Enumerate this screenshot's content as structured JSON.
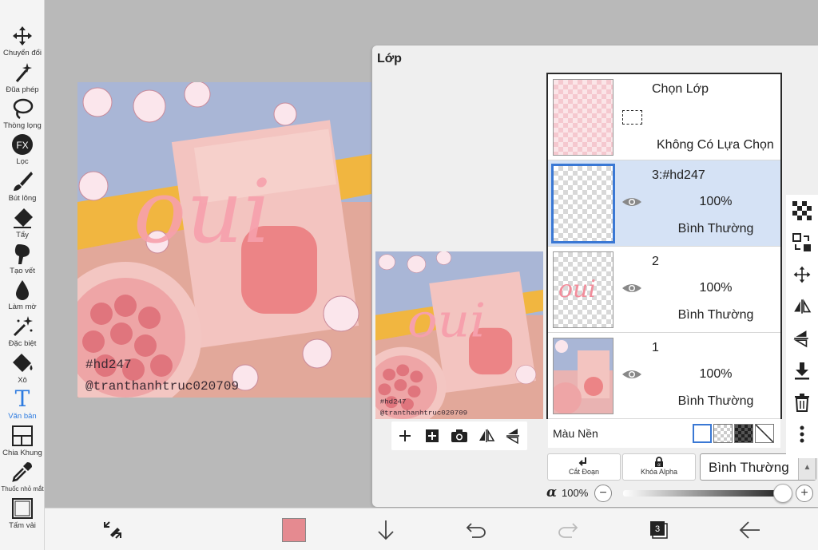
{
  "toolbar": {
    "tools": [
      {
        "label": "Chuyển đổi",
        "icon": "move-icon"
      },
      {
        "label": "Đũa phép",
        "icon": "magic-wand-icon"
      },
      {
        "label": "Thòng lọng",
        "icon": "lasso-icon"
      },
      {
        "label": "Lọc",
        "icon": "fx-icon",
        "badge": "FX"
      },
      {
        "label": "Bút lông",
        "icon": "brush-icon"
      },
      {
        "label": "Tẩy",
        "icon": "eraser-icon"
      },
      {
        "label": "Tạo vết",
        "icon": "smudge-icon"
      },
      {
        "label": "Làm mờ",
        "icon": "blur-icon"
      },
      {
        "label": "Đặc biệt",
        "icon": "special-icon"
      },
      {
        "label": "Xô",
        "icon": "bucket-icon"
      },
      {
        "label": "Văn bản",
        "icon": "text-icon",
        "glyph": "T",
        "active": true
      },
      {
        "label": "Chia Khung",
        "icon": "frame-divider-icon"
      },
      {
        "label": "Thuốc nhỏ mắt",
        "icon": "eyedropper-icon"
      },
      {
        "label": "Tấm vải",
        "icon": "canvas-icon"
      }
    ]
  },
  "artwork": {
    "watermark_line1": "#hd247",
    "watermark_line2": "@tranthanhtruc020709",
    "overlay_text": "oui"
  },
  "layer_panel": {
    "title": "Lớp",
    "selection_layer": {
      "title": "Chọn Lớp",
      "status": "Không Có Lựa Chọn"
    },
    "layers": [
      {
        "name": "3:#hd247",
        "opacity": "100%",
        "mode": "Bình Thường",
        "selected": true
      },
      {
        "name": "2",
        "opacity": "100%",
        "mode": "Bình Thường",
        "selected": false
      },
      {
        "name": "1",
        "opacity": "100%",
        "mode": "Bình Thường",
        "selected": false
      }
    ],
    "background": {
      "label": "Màu Nền"
    },
    "clip_label": "Cắt Đoạn",
    "alpha_lock_label": "Khóa Alpha",
    "blend_mode": "Bình Thường",
    "alpha_symbol": "α",
    "alpha_value": "100%",
    "alpha_level": 1.0
  },
  "bottombar": {
    "layer_count": "3",
    "current_color": "#e58a90"
  },
  "colors": {
    "accent": "#2d7be0",
    "selected_row": "#d5e2f5",
    "pink": "#f4a3ad"
  }
}
